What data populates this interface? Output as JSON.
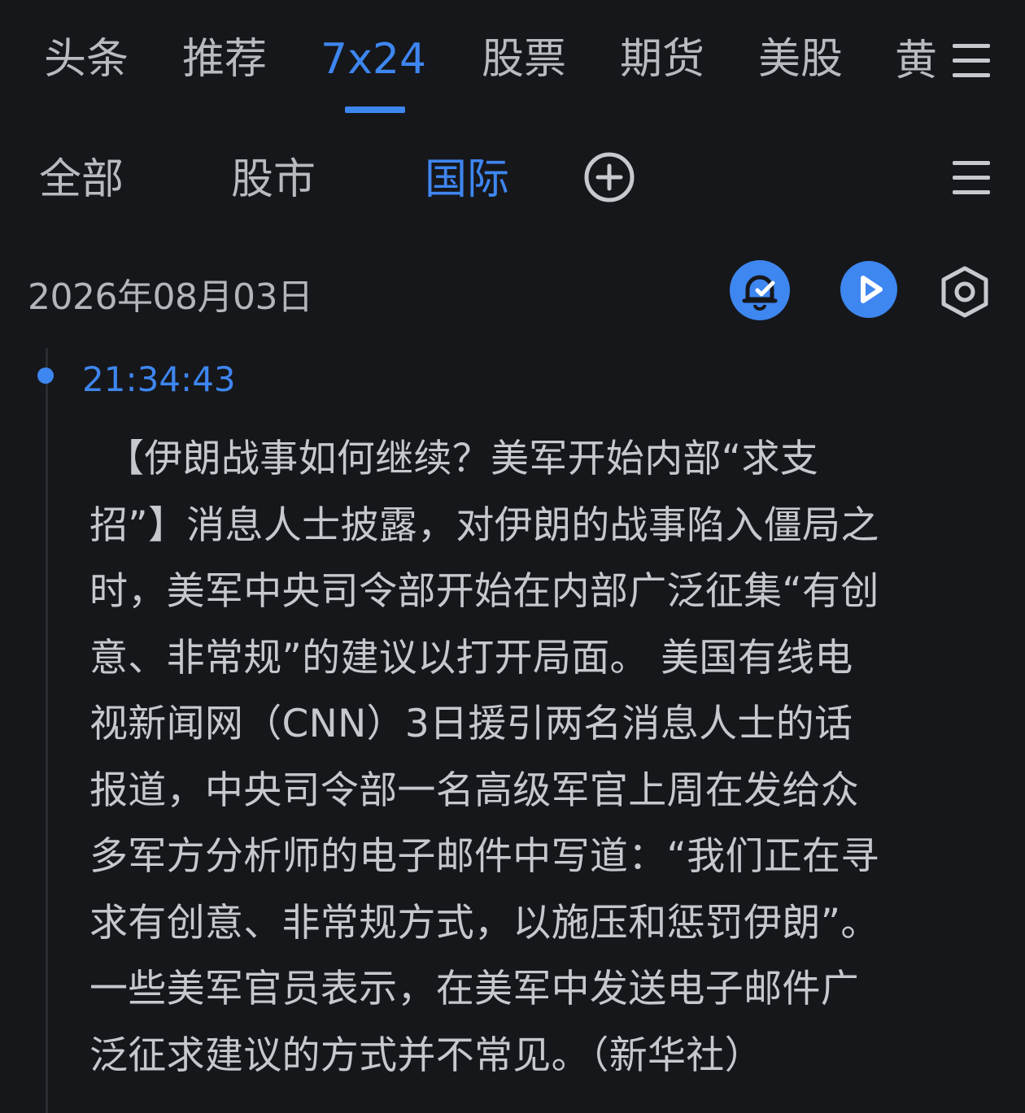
{
  "top_tabs": {
    "items": [
      {
        "label": "头条",
        "active": false
      },
      {
        "label": "推荐",
        "active": false
      },
      {
        "label": "7x24",
        "active": true
      },
      {
        "label": "股票",
        "active": false
      },
      {
        "label": "期货",
        "active": false
      },
      {
        "label": "美股",
        "active": false
      }
    ],
    "overflow_label": "黄",
    "menu_icon": "hamburger-menu-icon"
  },
  "sub_tabs": {
    "items": [
      {
        "label": "全部",
        "active": false
      },
      {
        "label": "股市",
        "active": false
      },
      {
        "label": "国际",
        "active": true
      }
    ],
    "add_icon": "add-circle-icon",
    "menu_icon": "hamburger-menu-icon"
  },
  "date_row": {
    "date": "2026年08月03日",
    "actions": [
      {
        "icon": "alarm-check-icon"
      },
      {
        "icon": "play-icon"
      },
      {
        "icon": "hexagon-settings-icon"
      }
    ]
  },
  "feed": {
    "items": [
      {
        "time": "21:34:43",
        "lines": [
          "【伊朗战事如何继续？美军开始内部“求支",
          "招”】消息人士披露，对伊朗的战事陷入僵局之",
          "时，美军中央司令部开始在内部广泛征集“有创",
          "意、非常规”的建议以打开局面。 美国有线电",
          "视新闻网（CNN）3日援引两名消息人士的话",
          "报道，中央司令部一名高级军官上周在发给众",
          "多军方分析师的电子邮件中写道：“我们正在寻",
          "求有创意、非常规方式，以施压和惩罚伊朗”。",
          "一些美军官员表示，在美军中发送电子邮件广",
          "泛征求建议的方式并不常见。（新华社）"
        ]
      }
    ]
  },
  "colors": {
    "background": "#16171b",
    "accent": "#3e86f0",
    "text": "#c6c8ce"
  }
}
